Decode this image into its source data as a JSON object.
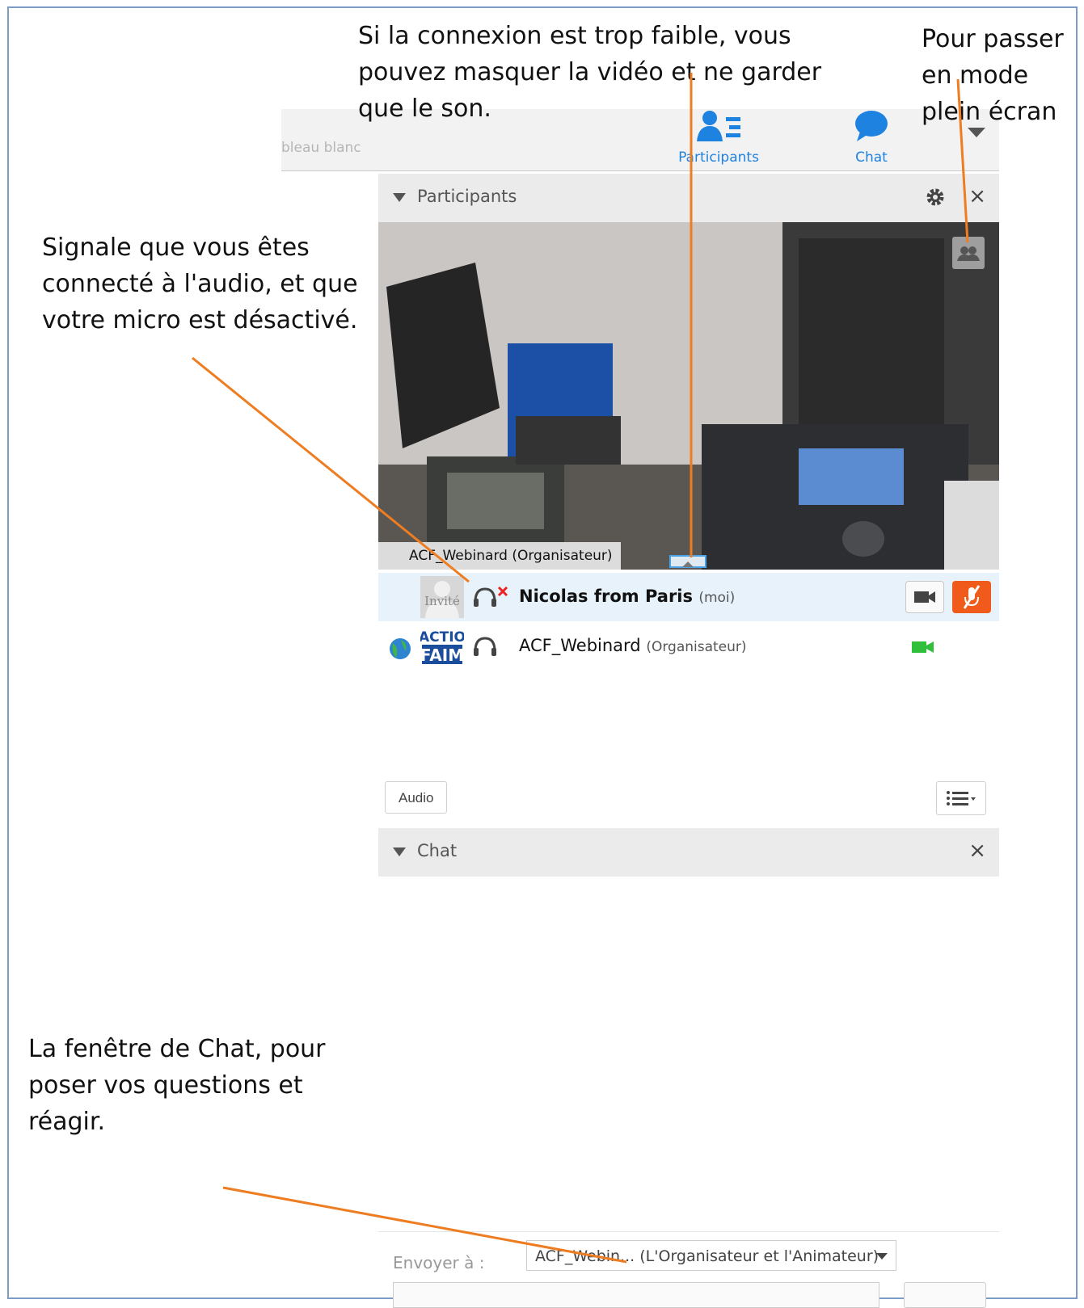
{
  "annotations": {
    "video": "Si la connexion est trop faible, vous\npouvez masquer la vidéo et ne garder\nque le son.",
    "fullscreen": "Pour passer\nen mode\nplein écran",
    "audio": "Signale que vous êtes\nconnecté à l'audio, et que\nvotre micro est désactivé.",
    "chat": "La fenêtre de Chat, pour\nposer vos questions et\nréagir."
  },
  "toolbar": {
    "whiteboard_label": "bleau blanc",
    "participants_label": "Participants",
    "chat_label": "Chat"
  },
  "participants_panel": {
    "title": "Participants",
    "close": "×",
    "video_label": "ACF_Webinard (Organisateur)",
    "rows": [
      {
        "avatar_text": "Invité",
        "name": "Nicolas from Paris",
        "role": "(moi)"
      },
      {
        "avatar_text": "ACTIO FAIM",
        "name": "ACF_Webinard",
        "role": "(Organisateur)"
      }
    ],
    "audio_button": "Audio"
  },
  "chat_panel": {
    "title": "Chat",
    "close": "×",
    "send_to_label": "Envoyer à :",
    "send_to_value": "ACF_Webin...  (L'Organisateur et l'Animateur)"
  },
  "colors": {
    "accent_blue": "#1e82e0",
    "annotation_orange": "#ee7d22",
    "mute_orange": "#f05a1a",
    "camera_green": "#2fbf3a"
  }
}
